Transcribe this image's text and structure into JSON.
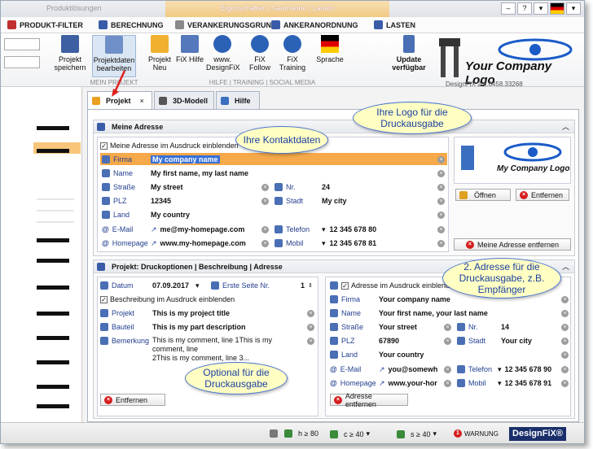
{
  "titlebar": {
    "left_title": "Produktlösungen",
    "context_title": "Eigenschaften | Geometrie | Lasten"
  },
  "menu": [
    {
      "label": "PRODUKT-FILTER",
      "color": "#c03030"
    },
    {
      "label": "BERECHNUNG",
      "color": "#3a5ca8"
    },
    {
      "label": "VERANKERUNGSGRUND",
      "color": "#8a8a8a"
    },
    {
      "label": "ANKERANORDNUNG",
      "color": "#3a5ca8"
    },
    {
      "label": "LASTEN",
      "color": "#3a5ca8"
    }
  ],
  "ribbon": {
    "buttons": [
      {
        "label": "Projekt speichern"
      },
      {
        "label": "Projektdaten bearbeiten"
      },
      {
        "label": "Projekt Neu"
      },
      {
        "label": "FiX Hilfe"
      },
      {
        "label": "www. DesignFiX"
      },
      {
        "label": "FiX Follow"
      },
      {
        "label": "FiX Training"
      },
      {
        "label": "Sprache"
      },
      {
        "label": "Update verfügbar"
      }
    ],
    "groups": {
      "project": "MEIN PROJEKT",
      "help": "HILFE | TRAINING | SOCIAL MEDIA"
    },
    "version": "DesignFiX 2.4.6458.33268",
    "logo_text": "Your Company Logo"
  },
  "tabs": [
    {
      "label": "Projekt",
      "close": "×"
    },
    {
      "label": "3D-Modell"
    },
    {
      "label": "Hilfe"
    }
  ],
  "address": {
    "title": "Meine Adresse",
    "print_check": "Meine Adresse im Ausdruck einblenden",
    "firma_l": "Firma",
    "firma_v": "My company name",
    "name_l": "Name",
    "name_v": "My first name, my last name",
    "strasse_l": "Straße",
    "strasse_v": "My street",
    "nr_l": "Nr.",
    "nr_v": "24",
    "plz_l": "PLZ",
    "plz_v": "12345",
    "stadt_l": "Stadt",
    "stadt_v": "My city",
    "land_l": "Land",
    "land_v": "My country",
    "email_l": "E-Mail",
    "email_v": "me@my-homepage.com",
    "tel_l": "Telefon",
    "tel_v": "12 345 678 80",
    "hp_l": "Homepage",
    "hp_v": "www.my-homepage.com",
    "mobil_l": "Mobil",
    "mobil_v": "12 345 678 81",
    "logo_text": "My Company Logo",
    "open_btn": "Öffnen",
    "remove_btn": "Entfernen",
    "remove_addr_btn": "Meine Adresse entfernen"
  },
  "print": {
    "title": "Projekt: Druckoptionen | Beschreibung | Adresse",
    "datum_l": "Datum",
    "datum_v": "07.09.2017",
    "first_page": "Erste Seite Nr.",
    "first_page_v": "1",
    "desc_check": "Beschreibung im Ausdruck einblenden",
    "projekt_l": "Projekt",
    "projekt_v": "This is my project title",
    "bauteil_l": "Bauteil",
    "bauteil_v": "This is my part description",
    "bem_l": "Bemerkung",
    "bem_v1": "This is my comment, line 1This is my comment, line",
    "bem_v2": "2This is my comment, line 3...",
    "remove_btn": "Entfernen"
  },
  "address2": {
    "print_check": "Adresse im Ausdruck einblenden",
    "firma_l": "Firma",
    "firma_v": "Your company name",
    "name_l": "Name",
    "name_v": "Your first name, your last name",
    "strasse_l": "Straße",
    "strasse_v": "Your street",
    "nr_l": "Nr.",
    "nr_v": "14",
    "plz_l": "PLZ",
    "plz_v": "67890",
    "stadt_l": "Stadt",
    "stadt_v": "Your city",
    "land_l": "Land",
    "land_v": "Your country",
    "email_l": "E-Mail",
    "email_v": "you@somewh",
    "tel_l": "Telefon",
    "tel_v": "12 345 678 90",
    "hp_l": "Homepage",
    "hp_v": "www.your-hor",
    "mobil_l": "Mobil",
    "mobil_v": "12 345 678 91",
    "remove_btn": "Adresse entfernen"
  },
  "callouts": {
    "logo": "Ihre Logo für die Druckausgabe",
    "contact": "Ihre Kontaktdaten",
    "second": "2. Adresse für die Druckausgabe, z.B. Empfänger",
    "optional": "Optional für die Druckausgabe"
  },
  "status": {
    "h": "h ≥ 80",
    "c": "c ≥ 40",
    "s": "s ≥ 40",
    "warn_count": "1",
    "warn": "WARNUNG",
    "brand": "DesignFiX®"
  }
}
